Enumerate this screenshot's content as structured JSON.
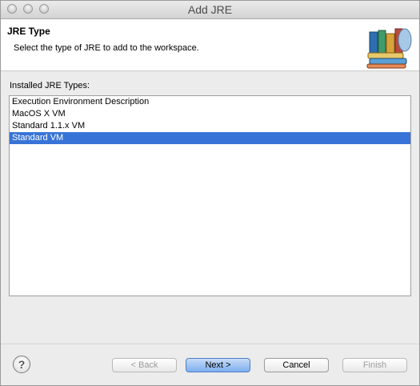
{
  "window": {
    "title": "Add JRE"
  },
  "header": {
    "title": "JRE Type",
    "description": "Select the type of JRE to add to the workspace."
  },
  "jre_types": {
    "label": "Installed JRE Types:",
    "items": [
      "Execution Environment Description",
      "MacOS X VM",
      "Standard 1.1.x VM",
      "Standard VM"
    ],
    "selected": "Standard VM"
  },
  "buttons": {
    "help": "?",
    "back": "< Back",
    "next": "Next >",
    "cancel": "Cancel",
    "finish": "Finish"
  },
  "icons": {
    "banner": "library-books-icon",
    "help": "help-icon"
  }
}
